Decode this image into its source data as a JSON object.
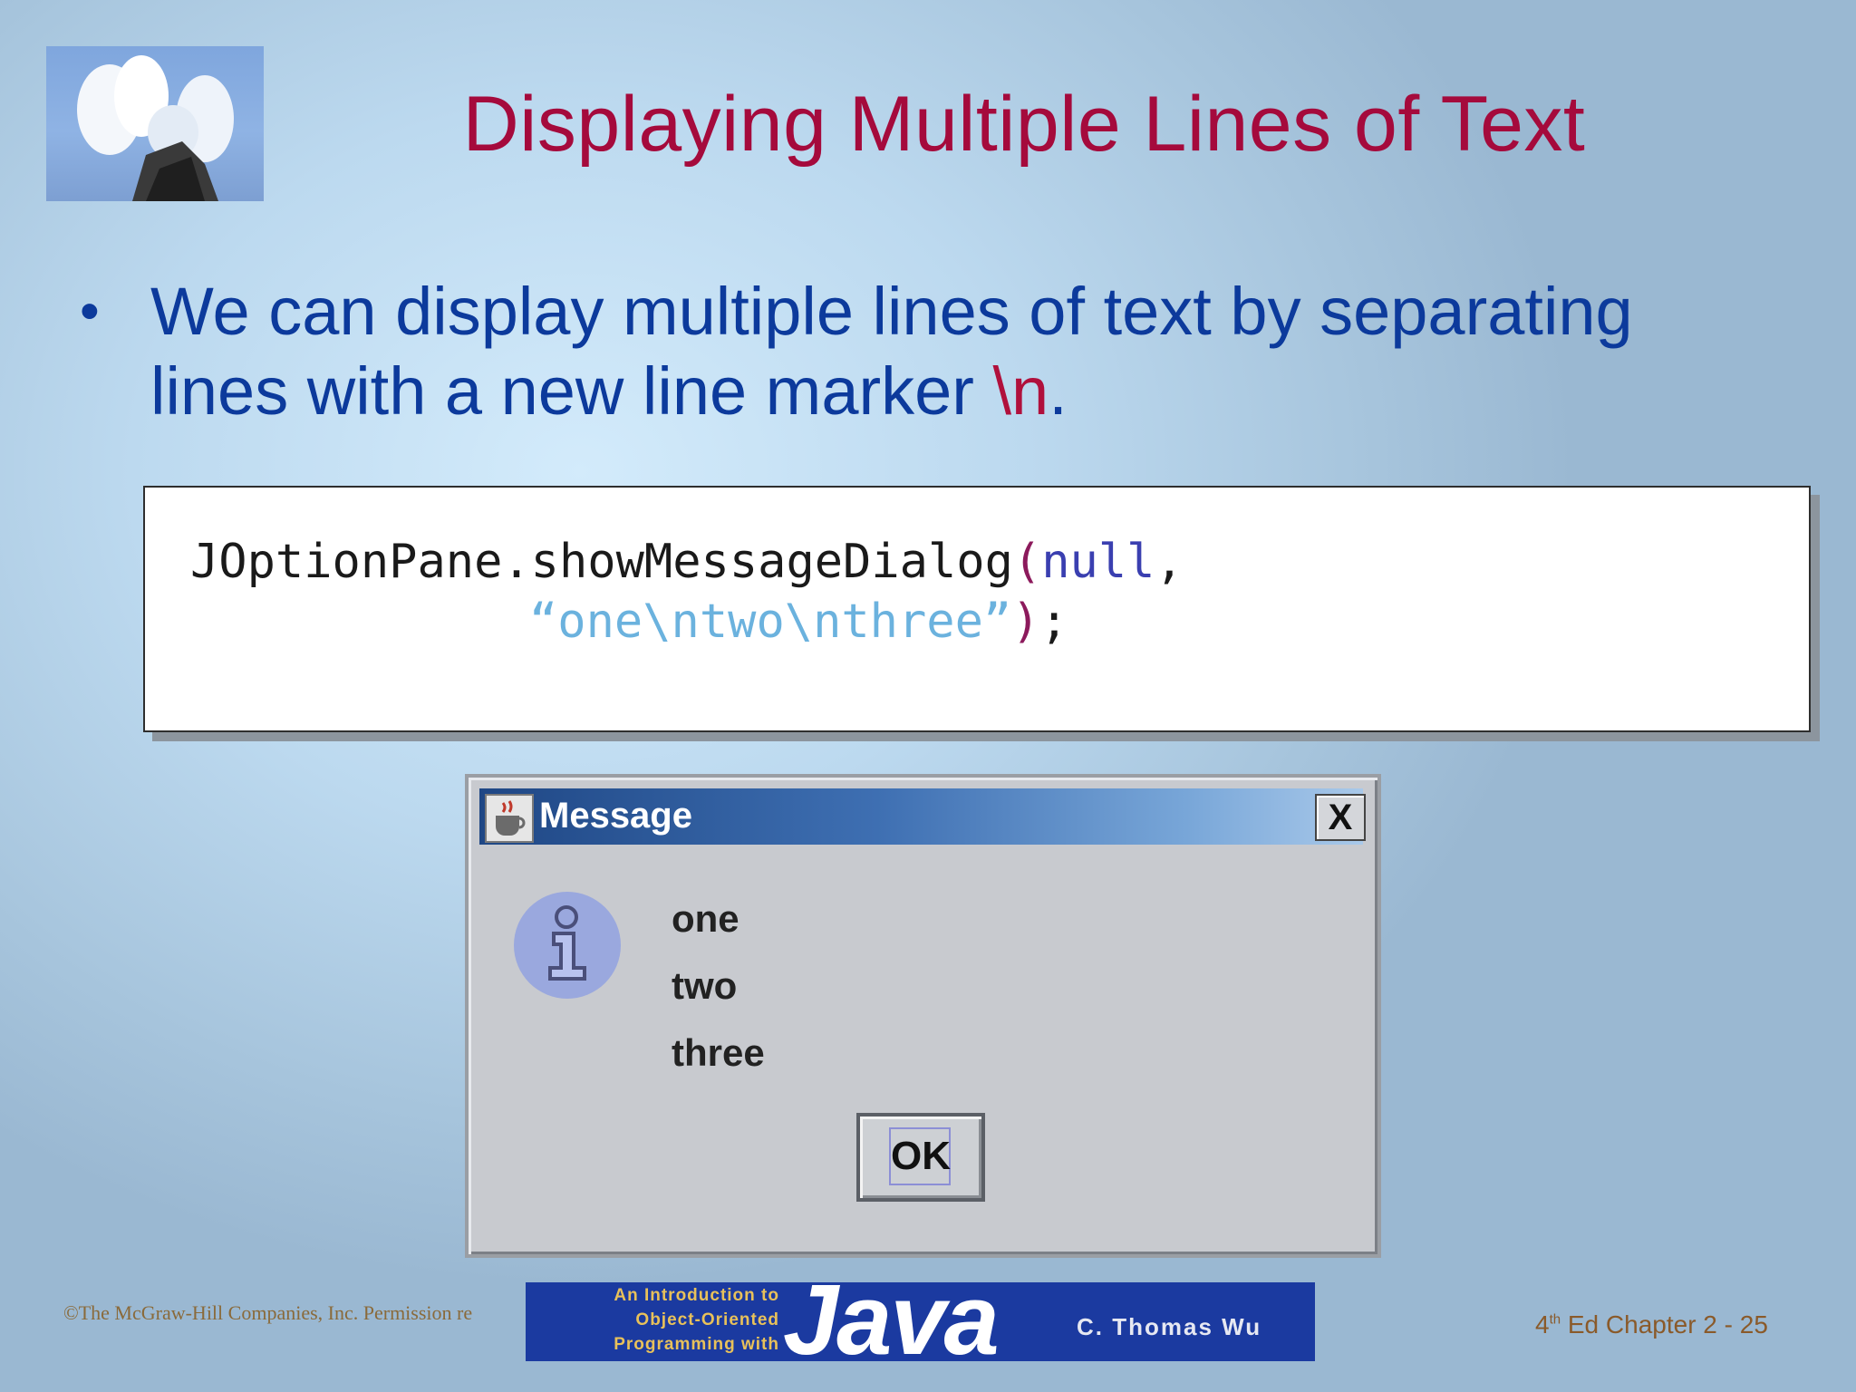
{
  "slide": {
    "title": "Displaying Multiple Lines of Text",
    "bullet": {
      "text_before": "We can display multiple lines of text by separating lines with a new line marker ",
      "marker": "\\n",
      "text_after": "."
    }
  },
  "code": {
    "line1_call": "JOptionPane.showMessageDialog",
    "line1_open_paren": "(",
    "line1_null": "null",
    "line1_comma": ",",
    "line2_string": "“one\\ntwo\\nthree”",
    "line2_close_paren": ")",
    "line2_semicolon": ";"
  },
  "dialog": {
    "title": "Message",
    "close_label": "X",
    "lines": [
      "one",
      "two",
      "three"
    ],
    "ok_label": "OK"
  },
  "footer": {
    "copyright": "©The McGraw-Hill Companies, Inc. Permission re",
    "banner": {
      "line1": "An Introduction to",
      "line2": "Object-Oriented",
      "line3": "Programming with",
      "java": "Java",
      "author": "C. Thomas Wu"
    },
    "edition_number": "4",
    "edition_suffix": "th",
    "chapter_text": " Ed Chapter 2 - 25"
  },
  "icons": [
    "slide-logo-photo",
    "java-cup-icon",
    "close-icon",
    "info-icon"
  ]
}
